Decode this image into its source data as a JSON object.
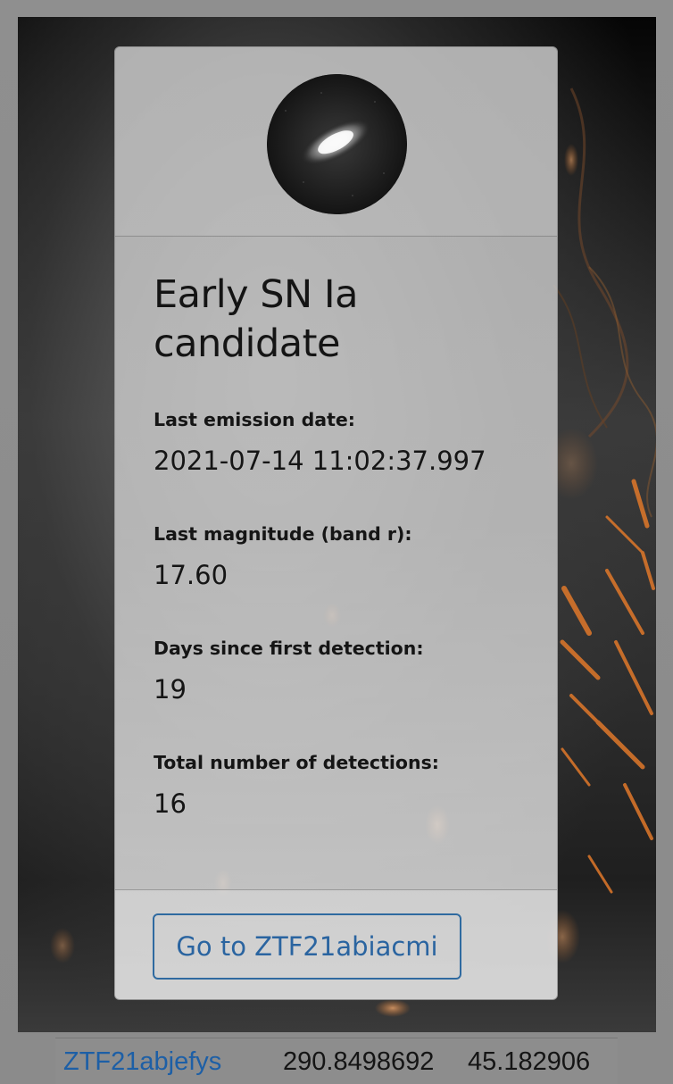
{
  "alert_card": {
    "title": "Early SN Ia candidate",
    "fields": [
      {
        "label": "Last emission date:",
        "value": "2021-07-14 11:02:37.997"
      },
      {
        "label": "Last magnitude (band r):",
        "value": "17.60"
      },
      {
        "label": "Days since first detection:",
        "value": "19"
      },
      {
        "label": "Total number of detections:",
        "value": "16"
      }
    ],
    "button_label": "Go to ZTF21abiacmi"
  },
  "table_row": {
    "object_id": "ZTF21abjefys",
    "ra": "290.8498692",
    "dec": "45.182906"
  },
  "colors": {
    "link": "#1d5fa6",
    "button_border": "#2f6aa0",
    "spark": "#e0782a"
  },
  "icons": {
    "thumbnail": "galaxy-cutout-image"
  }
}
